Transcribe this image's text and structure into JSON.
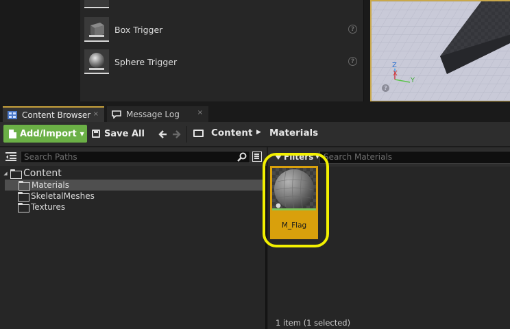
{
  "place_panel": {
    "items": [
      {
        "label": "Box Trigger",
        "icon": "box-trigger-icon"
      },
      {
        "label": "Sphere Trigger",
        "icon": "sphere-trigger-icon"
      }
    ],
    "help_glyph": "?"
  },
  "viewport": {
    "axis_z": "Z",
    "axis_x": "X",
    "axis_y": "Y",
    "help_glyph": "?"
  },
  "tabs": [
    {
      "label": "Content Browser",
      "active": true,
      "close": "×"
    },
    {
      "label": "Message Log",
      "active": false,
      "close": "×"
    }
  ],
  "toolbar": {
    "add_import_label": "Add/Import",
    "save_all_label": "Save All",
    "back_glyph": "🡐",
    "forward_glyph": "🡒",
    "breadcrumb": [
      "Content",
      "Materials"
    ],
    "crumb_separator": "▶"
  },
  "path_panel": {
    "search_placeholder": "Search Paths",
    "tree": [
      {
        "label": "Content",
        "level": 0,
        "expanded": true,
        "selected": false
      },
      {
        "label": "Materials",
        "level": 1,
        "selected": true
      },
      {
        "label": "SkeletalMeshes",
        "level": 1,
        "selected": false
      },
      {
        "label": "Textures",
        "level": 1,
        "selected": false
      }
    ]
  },
  "asset_panel": {
    "filters_label": "Filters",
    "search_placeholder": "Search Materials",
    "assets": [
      {
        "name": "M_Flag",
        "selected": true
      }
    ],
    "status": "1 item (1 selected)"
  },
  "colors": {
    "accent_green": "#6bb046",
    "selection_gold": "#d9a00c",
    "highlight_yellow": "#f2f000",
    "tab_accent": "#c8a23c"
  }
}
